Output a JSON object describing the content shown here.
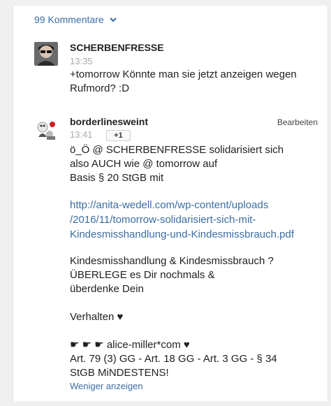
{
  "header": {
    "comments_label": "99 Kommentare"
  },
  "comments": [
    {
      "author": "SCHERBENFRESSE",
      "time": "13:35",
      "text_lines": [
        "+tomorrow Könnte man sie jetzt anzeigen wegen",
        "Rufmord? :D"
      ]
    },
    {
      "author": "borderlinesweint",
      "time": "13:41",
      "edit_label": "Bearbeiten",
      "plus_label": "+1",
      "para1": [
        "ö_Ö @ SCHERBENFRESSE solidarisiert sich",
        "also AUCH wie @ tomorrow auf",
        "Basis § 20 StGB mit"
      ],
      "link_lines": [
        "http://anita-wedell.com/wp-content/uploads",
        "/2016/11/tomorrow-solidarisiert-sich-mit-",
        "Kindesmisshandlung-und-Kindesmissbrauch.pdf"
      ],
      "para2": [
        "Kindesmisshandlung & Kindesmissbrauch ?",
        "ÜBERLEGE es Dir nochmals &",
        "überdenke Dein"
      ],
      "para3": "Verhalten ♥",
      "para4": [
        "☛ ☛ ☛ alice-miller*com ♥",
        "Art. 79 (3) GG - Art. 18 GG - Art. 3 GG - § 34",
        "StGB MiNDESTENS!"
      ],
      "less_label": "Weniger anzeigen"
    }
  ]
}
